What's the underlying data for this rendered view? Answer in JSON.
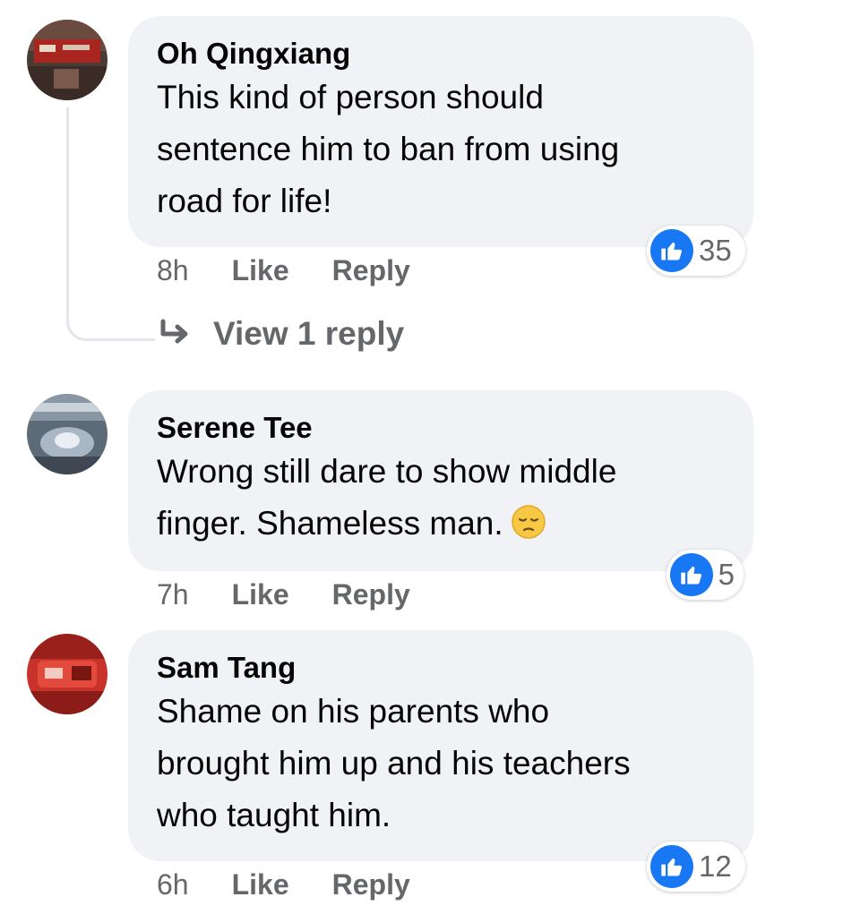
{
  "colors": {
    "bubble_bg": "#f0f2f5",
    "like_blue": "#1877f2",
    "meta_text": "#65676b",
    "body_text": "#050505"
  },
  "comments": [
    {
      "author": "Oh Qingxiang",
      "text": "This kind of person should\nsentence him to ban from using\nroad for life!",
      "reaction_count": "35",
      "reaction_icon": "thumbs-up-icon",
      "time": "8h",
      "like_label": "Like",
      "reply_label": "Reply",
      "view_replies": "View 1 reply",
      "avatar_icon": "profile-photo"
    },
    {
      "author": "Serene Tee",
      "text": "Wrong still dare to show middle\nfinger. Shameless man.",
      "emoji": "pensive-face-emoji",
      "reaction_count": "5",
      "reaction_icon": "thumbs-up-icon",
      "time": "7h",
      "like_label": "Like",
      "reply_label": "Reply",
      "avatar_icon": "profile-photo"
    },
    {
      "author": "Sam Tang",
      "text": "Shame on his parents who\nbrought him up and his teachers\nwho taught him.",
      "reaction_count": "12",
      "reaction_icon": "thumbs-up-icon",
      "time": "6h",
      "like_label": "Like",
      "reply_label": "Reply",
      "avatar_icon": "profile-photo"
    }
  ]
}
